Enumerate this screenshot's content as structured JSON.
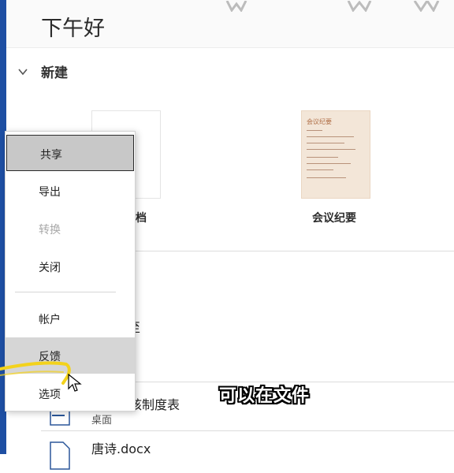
{
  "header": {
    "greeting": "下午好"
  },
  "new_section": {
    "title": "新建"
  },
  "templates": [
    {
      "label": "文档",
      "visible_label": "档"
    },
    {
      "label": "会议纪要",
      "thumb_title": "会议纪要"
    }
  ],
  "recent": [
    {
      "name": "员工考核制度表",
      "location": "桌面",
      "icon": "word-doc-icon"
    },
    {
      "name": "唐诗.docx",
      "icon": "word-doc-icon"
    }
  ],
  "behind_menu_fragment": "至",
  "context_menu": {
    "items": [
      {
        "label": "共享",
        "state": "selected"
      },
      {
        "label": "导出",
        "state": "normal"
      },
      {
        "label": "转换",
        "state": "disabled"
      },
      {
        "label": "关闭",
        "state": "normal"
      },
      {
        "label": "帐户",
        "state": "normal"
      },
      {
        "label": "反馈",
        "state": "hover"
      },
      {
        "label": "选项",
        "state": "normal"
      }
    ]
  },
  "subtitle": "可以在文件",
  "colors": {
    "accent_blue": "#1e4fa3",
    "highlight_yellow": "#f3d21c",
    "menu_selected": "#c8c8c8"
  }
}
